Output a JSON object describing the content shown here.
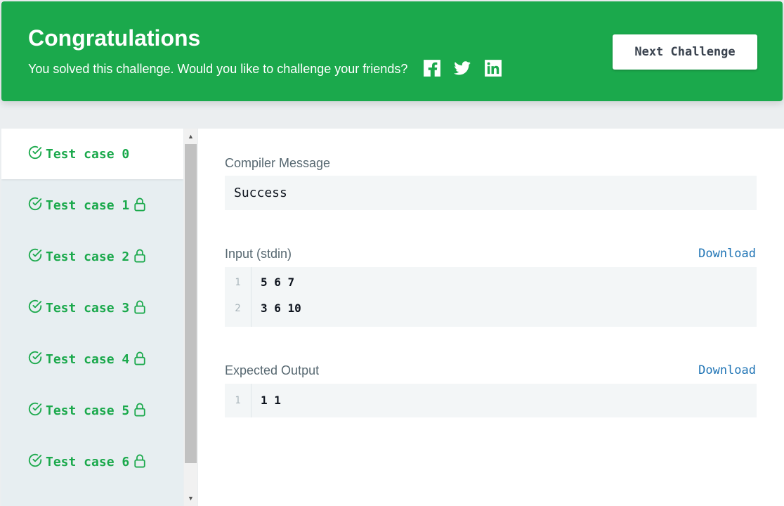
{
  "banner": {
    "title": "Congratulations",
    "subtitle": "You solved this challenge. Would you like to challenge your friends?",
    "social": [
      "facebook-icon",
      "twitter-icon",
      "linkedin-icon"
    ],
    "next_button": "Next Challenge",
    "color": "#1ba94c"
  },
  "test_cases": [
    {
      "label": "Test case 0",
      "status": "passed",
      "locked": false,
      "active": true
    },
    {
      "label": "Test case 1",
      "status": "passed",
      "locked": true,
      "active": false
    },
    {
      "label": "Test case 2",
      "status": "passed",
      "locked": true,
      "active": false
    },
    {
      "label": "Test case 3",
      "status": "passed",
      "locked": true,
      "active": false
    },
    {
      "label": "Test case 4",
      "status": "passed",
      "locked": true,
      "active": false
    },
    {
      "label": "Test case 5",
      "status": "passed",
      "locked": true,
      "active": false
    },
    {
      "label": "Test case 6",
      "status": "passed",
      "locked": true,
      "active": false
    }
  ],
  "compiler": {
    "label": "Compiler Message",
    "message": "Success"
  },
  "input": {
    "label": "Input (stdin)",
    "download": "Download",
    "lines": [
      {
        "num": "1",
        "text": "5 6 7"
      },
      {
        "num": "2",
        "text": "3 6 10"
      }
    ]
  },
  "expected": {
    "label": "Expected Output",
    "download": "Download",
    "lines": [
      {
        "num": "1",
        "text": "1 1"
      }
    ]
  }
}
